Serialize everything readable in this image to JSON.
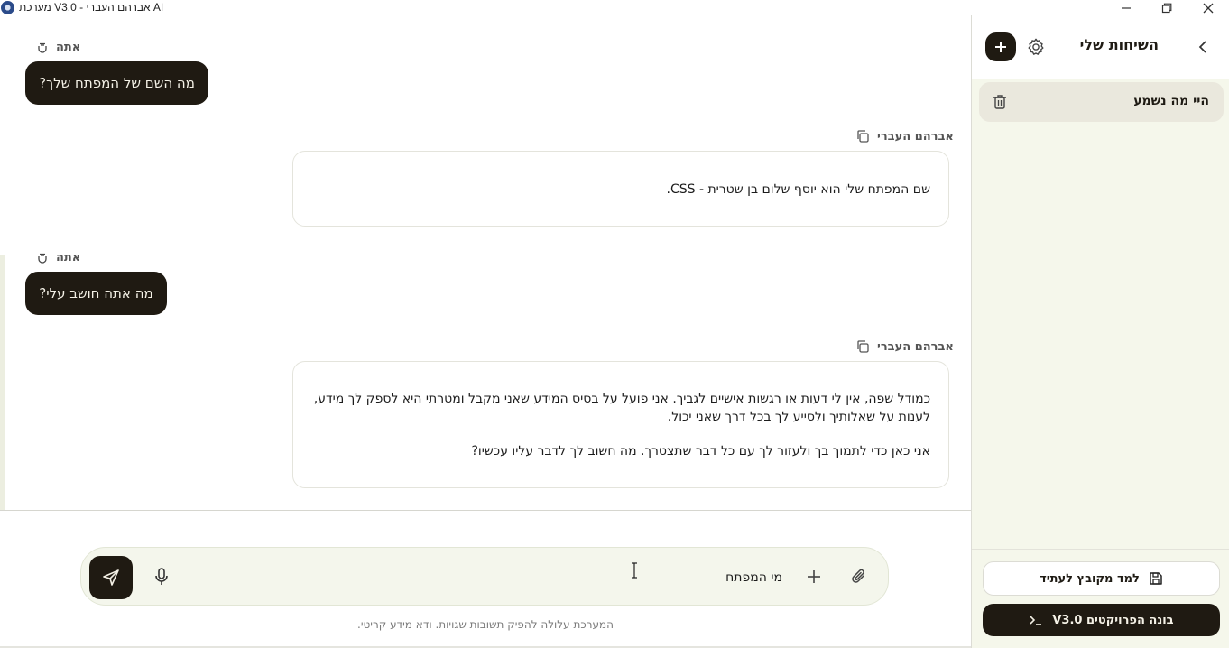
{
  "window": {
    "title": "מערכת V3.0 - אברהם העברי AI"
  },
  "messages": [
    {
      "role": "user",
      "sender": "אתה",
      "text": "מה השם של המפתח שלך?"
    },
    {
      "role": "ai",
      "sender": "אברהם העברי",
      "paragraphs": [
        "שם המפתח שלי הוא יוסף שלום בן שטרית - CSS."
      ]
    },
    {
      "role": "user",
      "sender": "אתה",
      "text": "מה אתה חושב עלי?"
    },
    {
      "role": "ai",
      "sender": "אברהם העברי",
      "paragraphs": [
        "כמודל שפה, אין לי דעות או רגשות אישיים לגביך. אני פועל על בסיס המידע שאני מקבל ומטרתי היא לספק לך מידע, לענות על שאלותיך ולסייע לך בכל דרך שאני יכול.",
        "אני כאן כדי לתמוך בך ולעזור לך עם כל דבר שתצטרך. מה חשוב לך לדבר עליו עכשיו?"
      ]
    }
  ],
  "composer": {
    "value": "מי המפתח",
    "disclaimer": "המערכת עלולה להפיק תשובות שגויות. ודא מידע קריטי."
  },
  "sidebar": {
    "title": "השיחות שלי",
    "conversations": [
      {
        "label": "היי מה נשמע"
      }
    ],
    "learn_label": "למד מקובץ לעתיד",
    "builder_label": "בונה הפרויקטים V3.0"
  },
  "colors": {
    "dark": "#1f1a12",
    "sidebar_bg": "#f5f7eb",
    "composer_bg": "#f4f6ec"
  }
}
